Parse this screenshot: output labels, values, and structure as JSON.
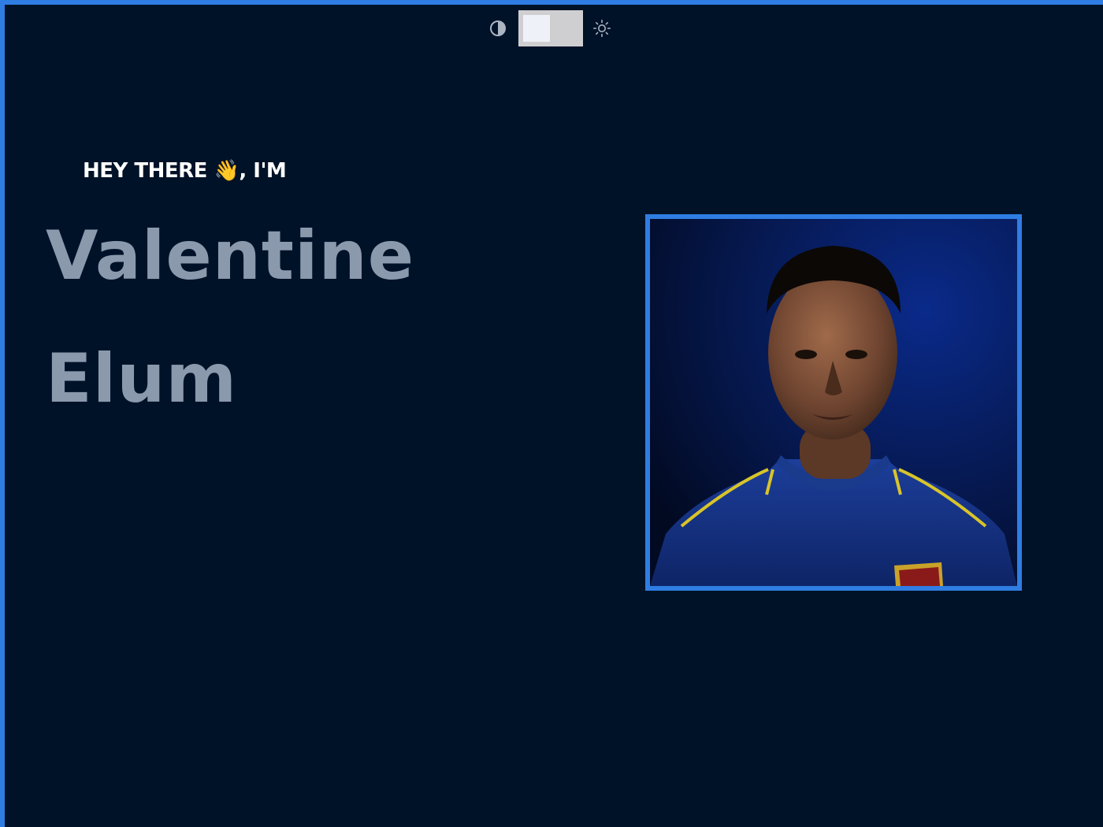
{
  "colors": {
    "accent": "#2f7de3",
    "background": "#001228",
    "name_text": "#8b99ad",
    "greeting_text": "#ffffff",
    "toggle_track": "#cfcfd1"
  },
  "theme_switcher": {
    "left_icon": "contrast-icon",
    "right_icon": "sun-icon",
    "toggle_state": "dark"
  },
  "hero": {
    "greeting": "HEY THERE 👋, I'M",
    "first_name": "Valentine",
    "last_name": "Elum",
    "photo": "portrait-photo"
  }
}
